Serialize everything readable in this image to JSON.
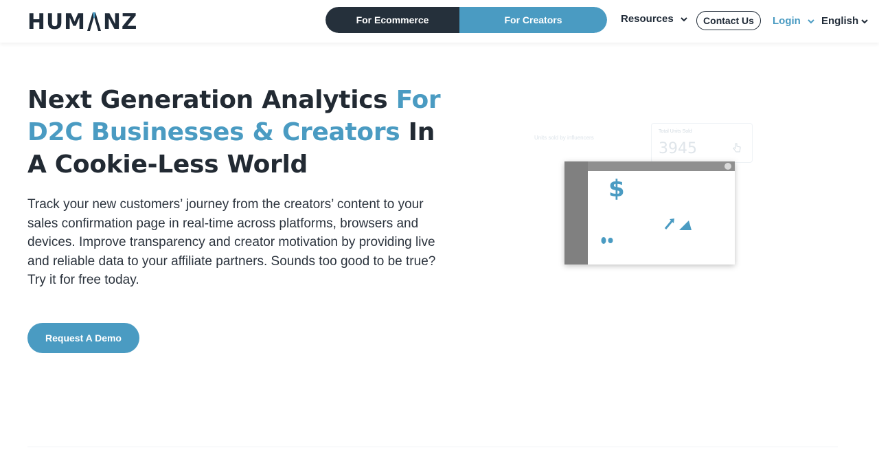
{
  "header": {
    "logo_text": "HUMANZ",
    "nav_toggle": {
      "ecommerce_label": "For Ecommerce",
      "creators_label": "For Creators"
    },
    "resources_label": "Resources",
    "contact_label": "Contact Us",
    "login_label": "Login",
    "language_label": "English"
  },
  "hero": {
    "headline": {
      "part1": "Next Generation Analytics ",
      "part2_blue": "For D2C Businesses & Creators",
      "part3": " In A Cookie-Less World"
    },
    "description": "Track your new customers’ journey from the creators’ content to your sales confirmation page in real-time across platforms, browsers and devices. Improve transparency and creator motivation by providing live and reliable data to your affiliate partners. Sounds too good to be true? Try it for free today.",
    "cta_label": "Request A Demo"
  },
  "illustration": {
    "card_label": "Total Units Sold",
    "card_value": "3945",
    "faint_text_1": "Units sold by influencers",
    "dollar_symbol": "$"
  },
  "colors": {
    "accent": "#4a9bc2",
    "dark": "#25303b",
    "text": "#222a33"
  },
  "icons": [
    "chevron-down-icon",
    "dollar-icon",
    "arrow-up-right-icon",
    "pie-slice-icon",
    "close-icon",
    "pointer-hand-icon"
  ]
}
